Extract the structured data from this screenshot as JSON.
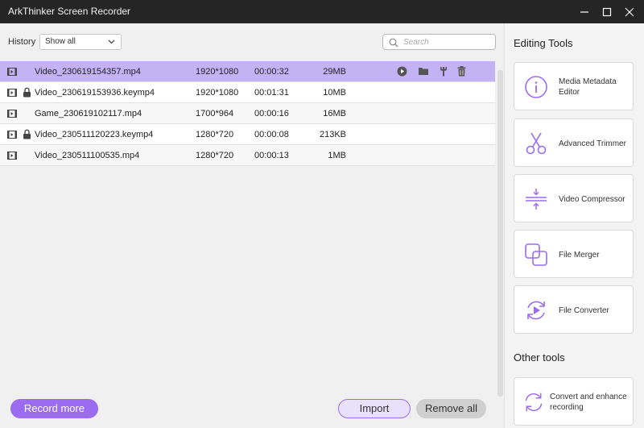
{
  "app": {
    "title": "ArkThinker Screen Recorder"
  },
  "history": {
    "label": "History",
    "filter": "Show all",
    "search_placeholder": "Search"
  },
  "recordings": [
    {
      "name": "Video_230619154357.mp4",
      "resolution": "1920*1080",
      "duration": "00:00:32",
      "size": "29MB",
      "locked": false,
      "selected": true
    },
    {
      "name": "Video_230619153936.keymp4",
      "resolution": "1920*1080",
      "duration": "00:01:31",
      "size": "10MB",
      "locked": true,
      "selected": false
    },
    {
      "name": "Game_230619102117.mp4",
      "resolution": "1700*964",
      "duration": "00:00:16",
      "size": "16MB",
      "locked": false,
      "selected": false
    },
    {
      "name": "Video_230511120223.keymp4",
      "resolution": "1280*720",
      "duration": "00:00:08",
      "size": "213KB",
      "locked": true,
      "selected": false
    },
    {
      "name": "Video_230511100535.mp4",
      "resolution": "1280*720",
      "duration": "00:00:13",
      "size": "1MB",
      "locked": false,
      "selected": false
    }
  ],
  "row_actions": [
    "play-icon",
    "folder-icon",
    "wrench-icon",
    "trash-icon"
  ],
  "buttons": {
    "record_more": "Record more",
    "import": "Import",
    "remove_all": "Remove all"
  },
  "editing_tools": {
    "title": "Editing Tools",
    "items": [
      {
        "label": "Media Metadata Editor",
        "icon": "info-icon"
      },
      {
        "label": "Advanced Trimmer",
        "icon": "scissors-icon"
      },
      {
        "label": "Video Compressor",
        "icon": "compress-icon"
      },
      {
        "label": "File Merger",
        "icon": "merge-icon"
      },
      {
        "label": "File Converter",
        "icon": "convert-icon"
      }
    ]
  },
  "other_tools": {
    "title": "Other tools",
    "items": [
      {
        "label": "Convert and enhance recording",
        "icon": "enhance-icon"
      }
    ]
  },
  "colors": {
    "accent": "#9b6cf0",
    "selected_row": "#c3b3f5",
    "titlebar": "#252525"
  }
}
